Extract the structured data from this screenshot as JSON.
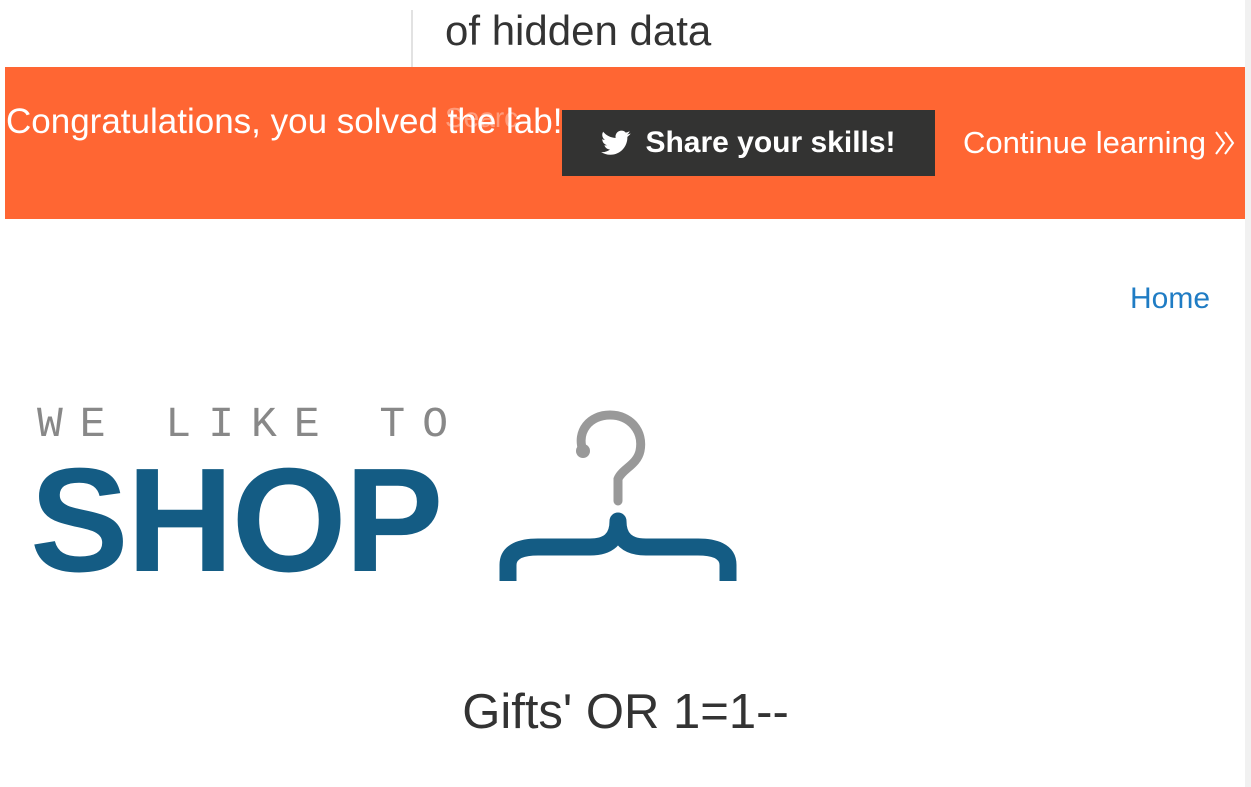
{
  "page": {
    "top_title": "of hidden data",
    "overlap_text": "Searc"
  },
  "banner": {
    "message": "Congratulations, you solved the lab!",
    "share_label": "Share your skills!",
    "share_icon": "twitter-bird-icon",
    "continue_label": "Continue learning",
    "continue_icon": "double-chevron-right-icon",
    "background_color": "#ff6633"
  },
  "nav": {
    "home_label": "Home"
  },
  "logo": {
    "tagline": "WE LIKE TO",
    "wordmark": "SHOP",
    "icon": "hanger-icon",
    "brand_color": "#145c84"
  },
  "search": {
    "heading": "Gifts' OR 1=1--"
  }
}
